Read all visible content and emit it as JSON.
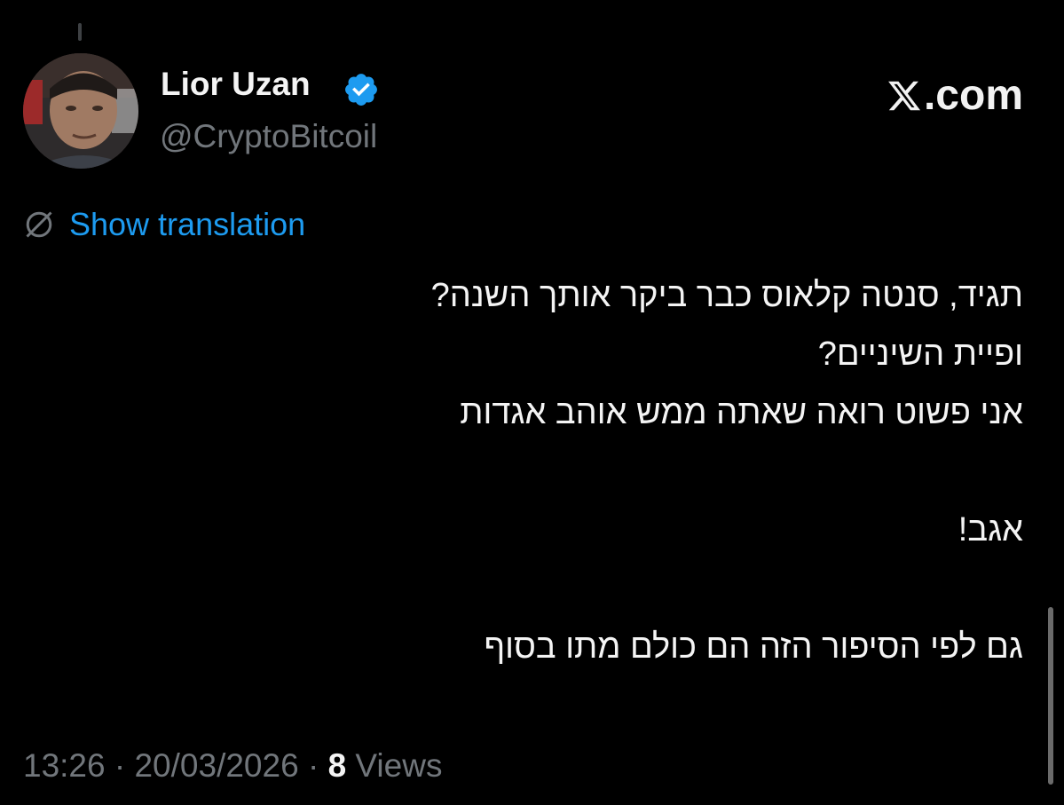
{
  "author": {
    "display_name": "Lior Uzan",
    "handle": "@CryptoBitcoil",
    "verified": true
  },
  "brand": {
    "label": ".com",
    "icon": "x-logo-icon"
  },
  "translation": {
    "link_label": "Show translation",
    "icon": "globe-icon"
  },
  "tweet": {
    "lines": [
      "תגיד, סנטה קלאוס כבר ביקר אותך השנה?",
      "ופיית השיניים?",
      "אני פשוט רואה שאתה ממש אוהב אגדות",
      "",
      "אגב!",
      "",
      "גם לפי הסיפור הזה הם כולם מתו בסוף"
    ]
  },
  "meta": {
    "time": "13:26",
    "separator": "·",
    "date": "20/03/2026",
    "views_count": "8",
    "views_label": "Views"
  },
  "colors": {
    "background": "#000000",
    "text_primary": "#f4f4f4",
    "text_secondary": "#71767b",
    "link": "#1d9bf0",
    "verified_badge": "#1d9bf0"
  }
}
